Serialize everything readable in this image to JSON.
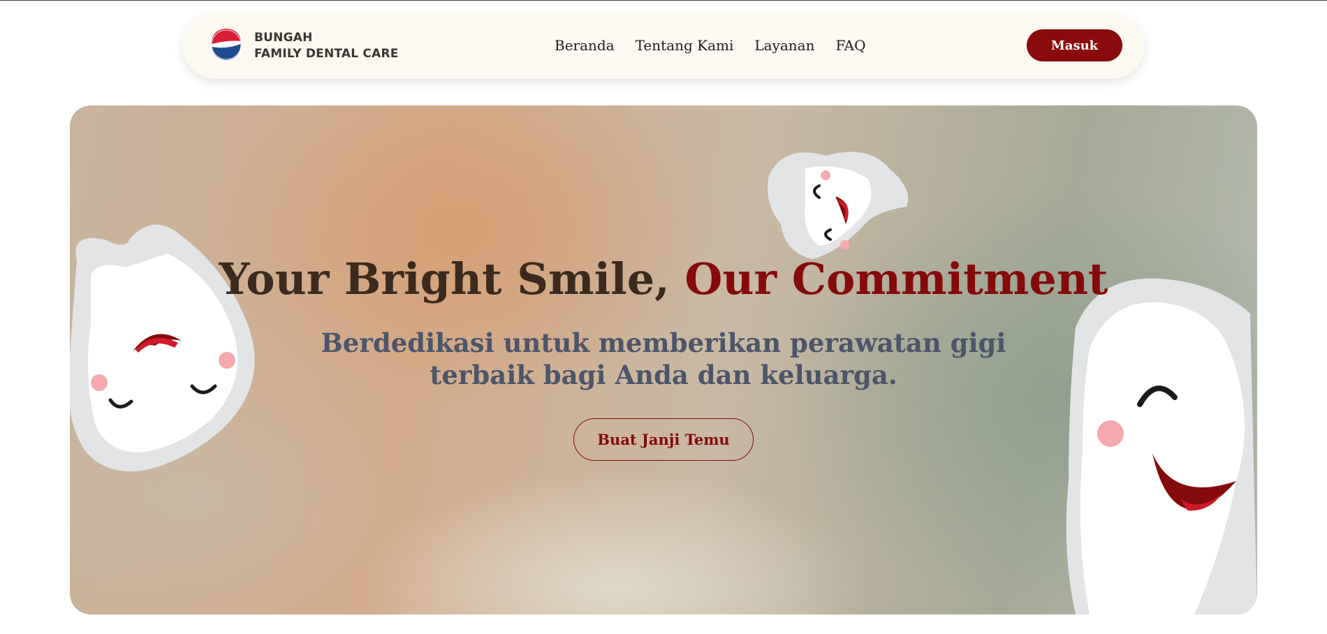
{
  "brand": {
    "name_line1": "BUNGAH",
    "name_line2": "FAMILY DENTAL CARE",
    "logo_icon": "pepsi-style-globe-logo"
  },
  "nav": {
    "links": [
      "Beranda",
      "Tentang Kami",
      "Layanan",
      "FAQ"
    ],
    "login_label": "Masuk"
  },
  "hero": {
    "headline_part1": "Your Bright Smile, ",
    "headline_accent": "Our Commitment",
    "subtitle_line1": "Berdedikasi untuk memberikan perawatan gigi",
    "subtitle_line2": "terbaik bagi Anda dan keluarga.",
    "cta_label": "Buat Janji Temu",
    "illustrations": [
      "smiling-tooth-left",
      "smiling-tooth-top",
      "smiling-tooth-right"
    ]
  },
  "colors": {
    "accent": "#850a0a",
    "button": "#8a0b0b",
    "navbar_bg": "#fcf9f3",
    "headline": "#3a2b1e",
    "subtitle": "#4c5569"
  }
}
